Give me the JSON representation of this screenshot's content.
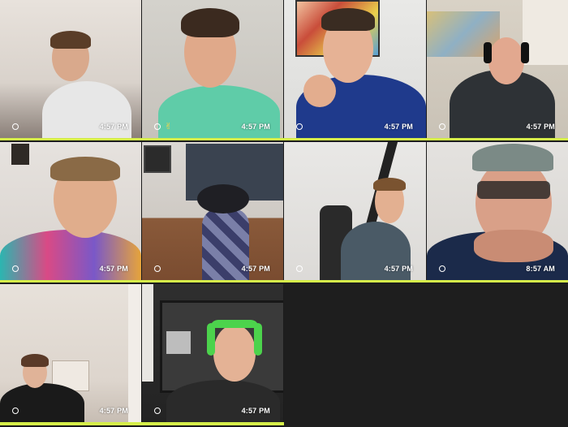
{
  "tiles": [
    {
      "time": "4:57 PM",
      "emoji": ""
    },
    {
      "time": "4:57 PM",
      "emoji": "✌"
    },
    {
      "time": "4:57 PM",
      "emoji": ""
    },
    {
      "time": "4:57 PM",
      "emoji": ""
    },
    {
      "time": "4:57 PM",
      "emoji": ""
    },
    {
      "time": "4:57 PM",
      "emoji": ""
    },
    {
      "time": "4:57 PM",
      "emoji": ""
    },
    {
      "time": "8:57 AM",
      "emoji": ""
    },
    {
      "time": "4:57 PM",
      "emoji": ""
    },
    {
      "time": "4:57 PM",
      "emoji": ""
    }
  ],
  "colors": {
    "accent_bar": "#d6f04a",
    "background": "#1e1e1e"
  }
}
